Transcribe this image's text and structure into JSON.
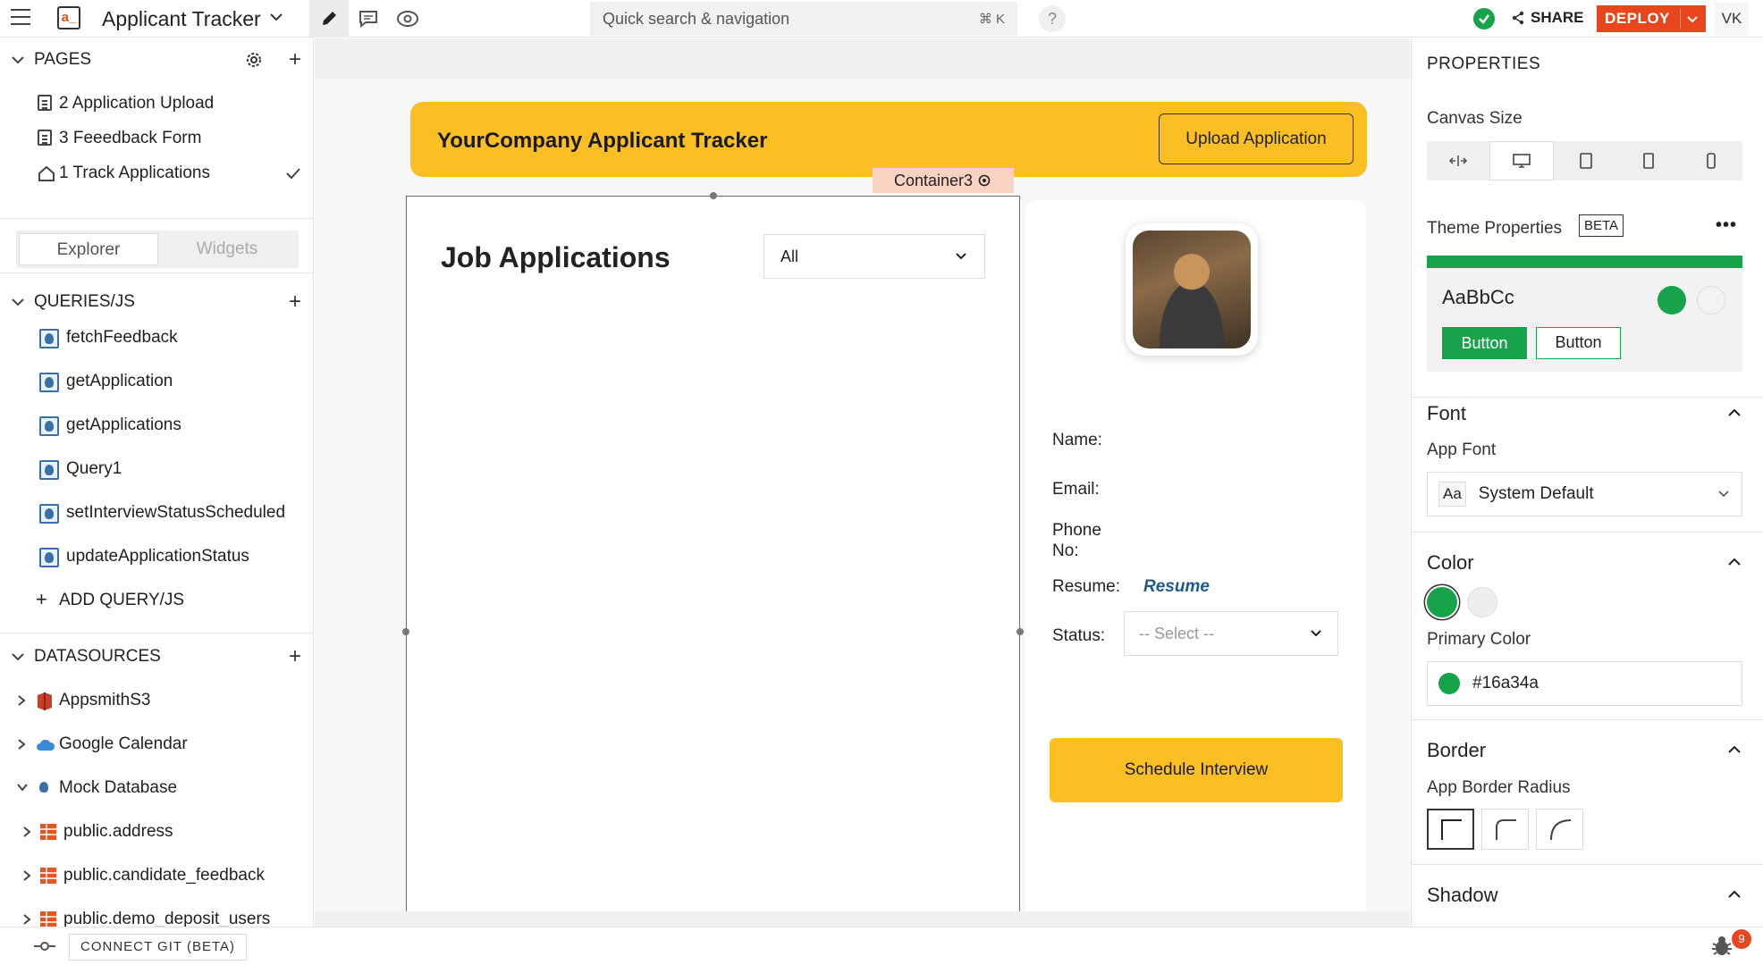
{
  "header": {
    "app_logo": "a_",
    "app_name": "Applicant Tracker",
    "search_placeholder": "Quick search & navigation",
    "search_shortcut": "⌘ K",
    "help": "?",
    "share_label": "SHARE",
    "deploy_label": "DEPLOY",
    "user_initials": "VK",
    "icons": [
      "hamburger-icon",
      "edit-icon",
      "comment-icon",
      "eye-icon",
      "check-circle-icon",
      "share-icon"
    ]
  },
  "sidebar": {
    "pages_title": "PAGES",
    "pages": [
      {
        "label": "2 Application Upload",
        "icon": "page-icon"
      },
      {
        "label": "3 Feeedback Form",
        "icon": "page-icon"
      },
      {
        "label": "1 Track Applications",
        "icon": "home-icon",
        "selected": true
      }
    ],
    "tabs": {
      "explorer": "Explorer",
      "widgets": "Widgets"
    },
    "queries_title": "QUERIES/JS",
    "queries": [
      "fetchFeedback",
      "getApplication",
      "getApplications",
      "Query1",
      "setInterviewStatusScheduled",
      "updateApplicationStatus"
    ],
    "add_query_label": "ADD QUERY/JS",
    "datasources_title": "DATASOURCES",
    "datasources": [
      {
        "label": "AppsmithS3",
        "icon": "s3-icon"
      },
      {
        "label": "Google Calendar",
        "icon": "cloud-icon"
      },
      {
        "label": "Mock Database",
        "icon": "postgres-icon",
        "expanded": true
      }
    ],
    "tables": [
      "public.address",
      "public.candidate_feedback",
      "public.demo_deposit_users"
    ]
  },
  "canvas": {
    "banner_title": "YourCompany Applicant Tracker",
    "upload_button": "Upload Application",
    "container_tag": "Container3",
    "job_title": "Job Applications",
    "job_filter_value": "All",
    "fields": {
      "name": "Name:",
      "email": "Email:",
      "phone": "Phone No:",
      "resume": "Resume:",
      "status": "Status:"
    },
    "resume_link": "Resume",
    "status_placeholder": "-- Select --",
    "schedule_button": "Schedule Interview",
    "accent": "#fbbf24"
  },
  "properties": {
    "title": "PROPERTIES",
    "canvas_size_label": "Canvas Size",
    "canvas_size_options": [
      "fluid",
      "desktop",
      "tablet-landscape",
      "tablet",
      "mobile"
    ],
    "canvas_size_selected": "desktop",
    "theme_label": "Theme Properties",
    "beta_badge": "BETA",
    "theme_preview": {
      "sample_text": "AaBbCc",
      "button_primary": "Button",
      "button_secondary": "Button"
    },
    "font_section": "Font",
    "app_font_label": "App Font",
    "font_icon": "Aa",
    "app_font_value": "System Default",
    "color_section": "Color",
    "colors": [
      "#16a34a",
      "#eeeeee"
    ],
    "primary_color_label": "Primary Color",
    "primary_color_value": "#16a34a",
    "border_section": "Border",
    "border_radius_label": "App Border Radius",
    "border_radius_options": [
      "none",
      "medium",
      "large"
    ],
    "border_radius_selected": "none",
    "shadow_section": "Shadow"
  },
  "footer": {
    "git_label": "CONNECT GIT (BETA)",
    "debugger_count": "9"
  }
}
